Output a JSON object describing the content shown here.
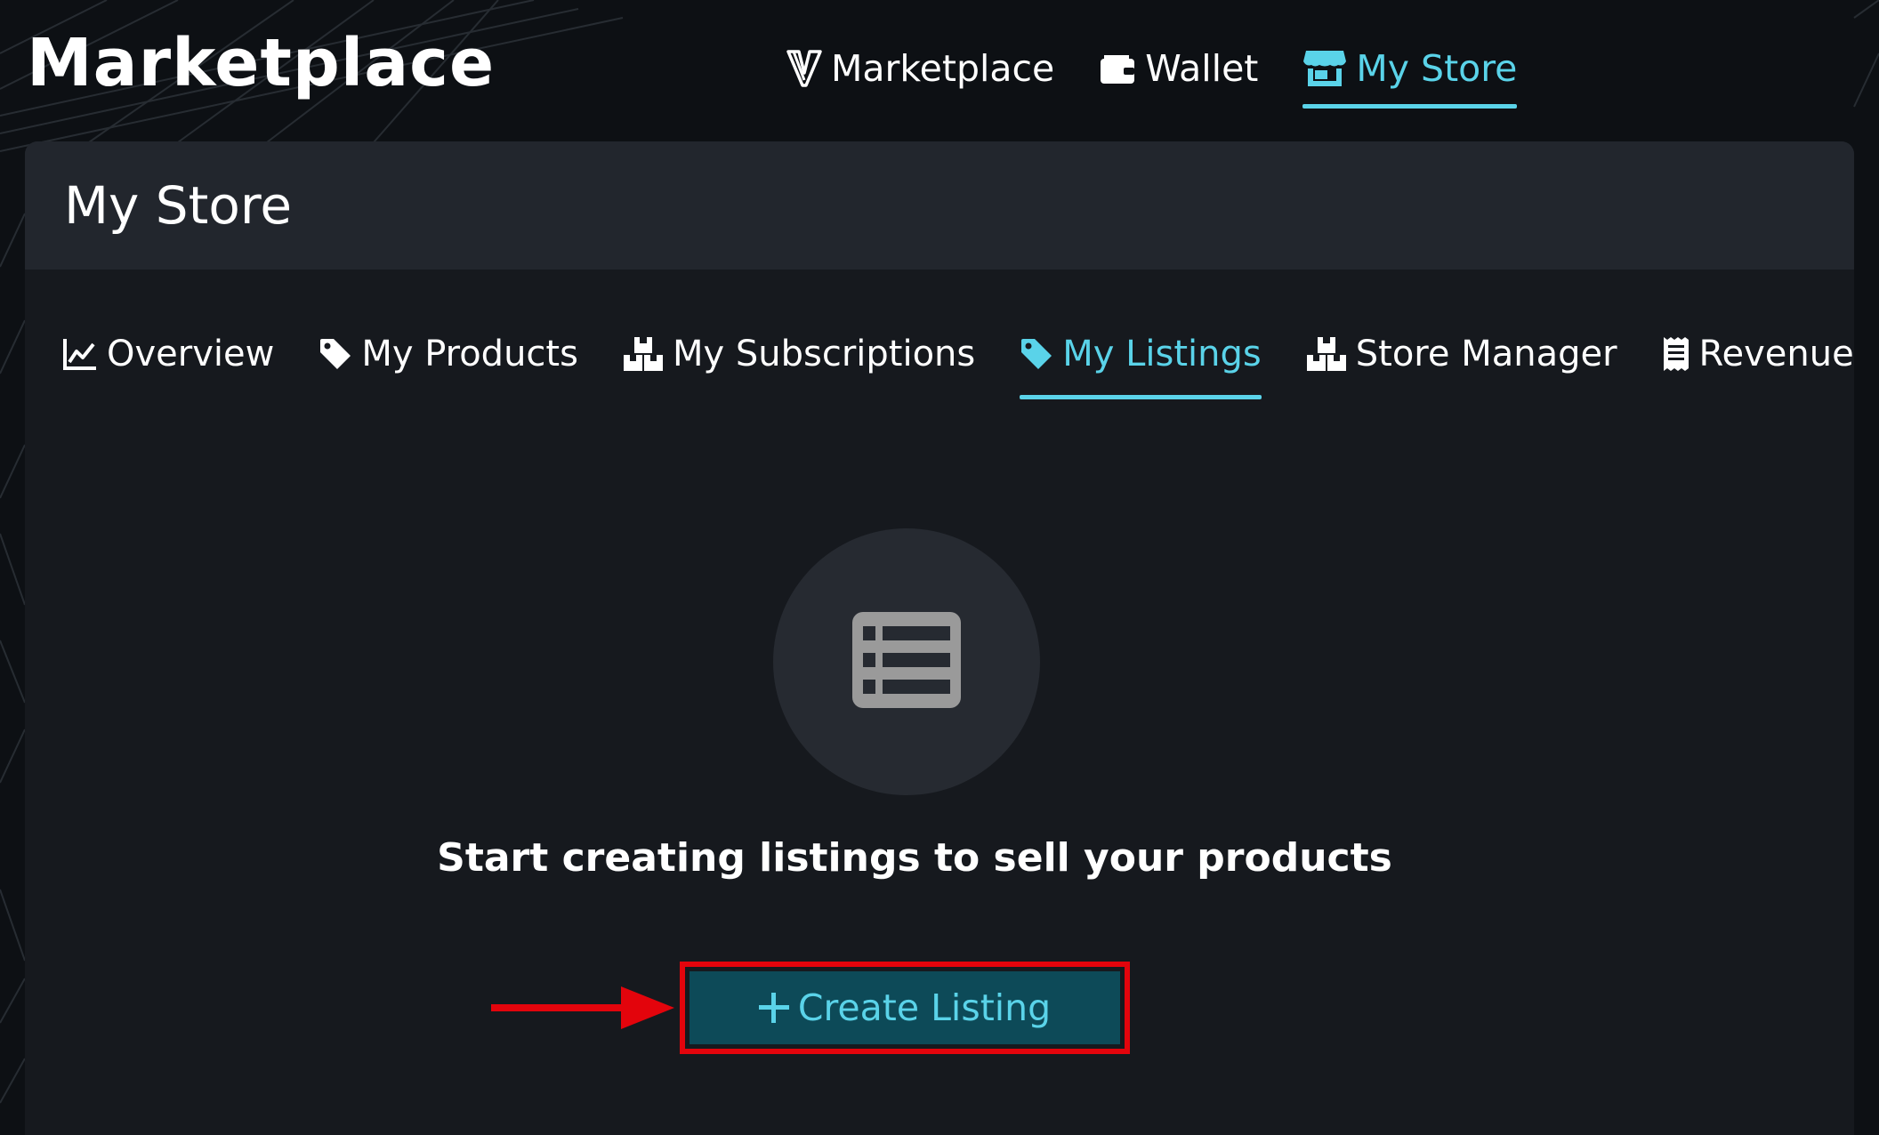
{
  "app": {
    "title": "Marketplace"
  },
  "top_nav": {
    "items": [
      {
        "label": "Marketplace",
        "icon": "v-logo-icon"
      },
      {
        "label": "Wallet",
        "icon": "wallet-icon"
      },
      {
        "label": "My Store",
        "icon": "store-icon",
        "active": true
      }
    ]
  },
  "panel": {
    "title": "My Store",
    "tabs": [
      {
        "label": "Overview",
        "icon": "chart-line-icon"
      },
      {
        "label": "My Products",
        "icon": "tag-icon"
      },
      {
        "label": "My Subscriptions",
        "icon": "boxes-icon"
      },
      {
        "label": "My Listings",
        "icon": "tag-icon",
        "active": true
      },
      {
        "label": "Store Manager",
        "icon": "boxes-icon"
      },
      {
        "label": "Revenue",
        "icon": "receipt-icon"
      }
    ],
    "empty_state": {
      "icon": "list-icon",
      "message": "Start creating listings to sell your products",
      "button_label": "Create Listing",
      "button_icon": "plus-icon"
    }
  },
  "colors": {
    "background": "#0d1014",
    "panel": "#16191e",
    "panel_header": "#22262d",
    "accent": "#5ad3e9",
    "button_bg": "#0d4a58",
    "highlight_red": "#e3040c"
  }
}
